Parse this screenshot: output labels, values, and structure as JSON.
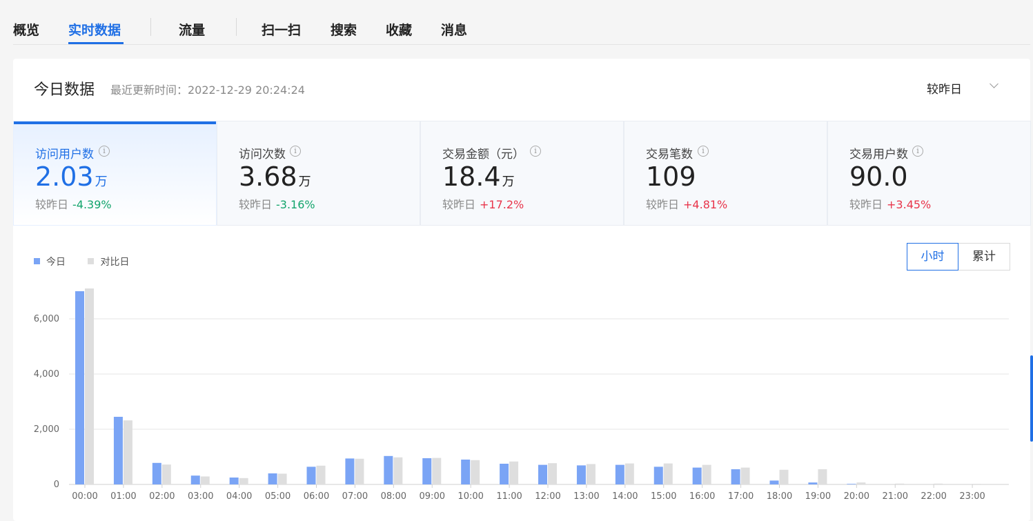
{
  "nav": {
    "tabs": [
      {
        "label": "概览"
      },
      {
        "label": "实时数据"
      },
      {
        "label": "流量"
      },
      {
        "label": "扫一扫"
      },
      {
        "label": "搜索"
      },
      {
        "label": "收藏"
      },
      {
        "label": "消息"
      }
    ],
    "active_tab": "实时数据"
  },
  "card": {
    "title": "今日数据",
    "updated": "最近更新时间：2022-12-29 20:24:24",
    "compare_select": "较昨日"
  },
  "metrics": [
    {
      "label": "访问用户数",
      "value": "2.03",
      "unit": "万",
      "compare_label": "较昨日",
      "change": "-4.39%",
      "trend": "down"
    },
    {
      "label": "访问次数",
      "value": "3.68",
      "unit": "万",
      "compare_label": "较昨日",
      "change": "-3.16%",
      "trend": "down"
    },
    {
      "label": "交易金额（元）",
      "value": "18.4",
      "unit": "万",
      "compare_label": "较昨日",
      "change": "+17.2%",
      "trend": "up"
    },
    {
      "label": "交易笔数",
      "value": "109",
      "unit": "",
      "compare_label": "较昨日",
      "change": "+4.81%",
      "trend": "up"
    },
    {
      "label": "交易用户数",
      "value": "90.0",
      "unit": "",
      "compare_label": "较昨日",
      "change": "+3.45%",
      "trend": "up"
    }
  ],
  "mode_toggle": {
    "hourly": "小时",
    "cumulative": "累计",
    "active": "小时"
  },
  "colors": {
    "accent": "#1f6fe5",
    "today": "#7aa4f5",
    "compare": "#dedede",
    "down": "#12a46b",
    "up": "#e8344a"
  },
  "chart_data": {
    "type": "bar",
    "categories": [
      "00:00",
      "01:00",
      "02:00",
      "03:00",
      "04:00",
      "05:00",
      "06:00",
      "07:00",
      "08:00",
      "09:00",
      "10:00",
      "11:00",
      "12:00",
      "13:00",
      "14:00",
      "15:00",
      "16:00",
      "17:00",
      "18:00",
      "19:00",
      "20:00",
      "21:00",
      "22:00",
      "23:00"
    ],
    "series": [
      {
        "name": "今日",
        "color": "#7aa4f5",
        "values": [
          7000,
          2450,
          780,
          320,
          250,
          400,
          640,
          940,
          1030,
          950,
          900,
          750,
          710,
          690,
          710,
          640,
          610,
          550,
          140,
          70,
          20,
          0,
          0,
          0
        ]
      },
      {
        "name": "对比日",
        "color": "#dedede",
        "values": [
          7100,
          2320,
          720,
          290,
          230,
          390,
          680,
          930,
          980,
          960,
          880,
          830,
          770,
          740,
          760,
          760,
          710,
          610,
          530,
          550,
          70,
          30,
          30,
          20
        ]
      }
    ],
    "ylim": [
      0,
      7500
    ],
    "yticks": [
      0,
      2000,
      4000,
      6000
    ],
    "ytick_labels": [
      "0",
      "2,000",
      "4,000",
      "6,000"
    ],
    "grid": true,
    "legend_position": "top-left"
  }
}
